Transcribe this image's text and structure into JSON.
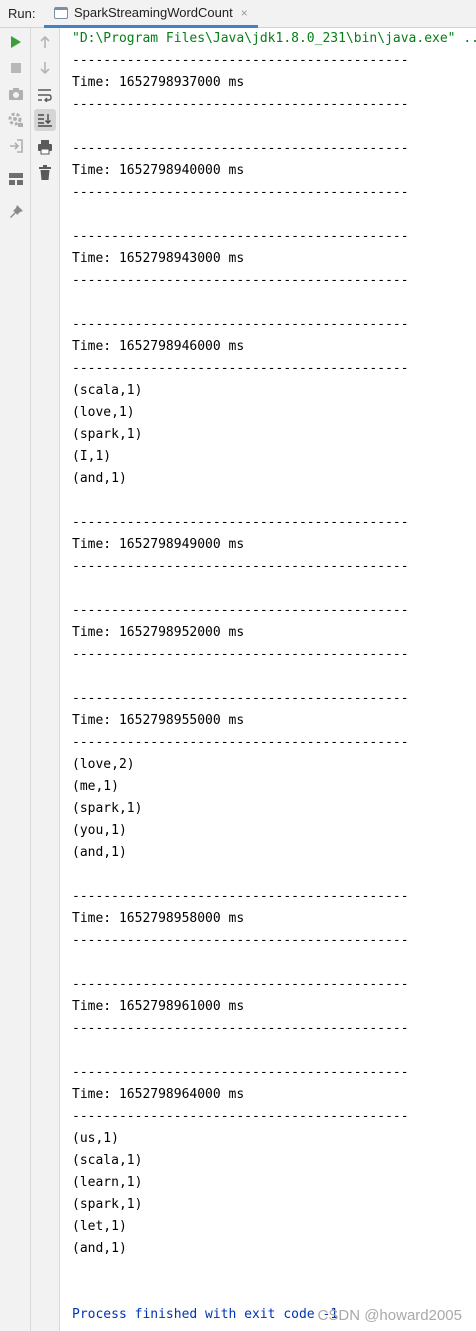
{
  "header": {
    "run_label": "Run:",
    "tab_title": "SparkStreamingWordCount",
    "tab_close": "×"
  },
  "toolbar_icons": [
    "run-icon",
    "stop-icon",
    "camera-icon",
    "settings-icon",
    "exit-icon",
    "layout-icon",
    "pin-icon",
    "arrow-up-icon",
    "arrow-down-icon",
    "soft-wrap-icon",
    "scroll-to-end-icon",
    "print-icon",
    "trash-icon"
  ],
  "console": {
    "command": "\"D:\\Program Files\\Java\\jdk1.8.0_231\\bin\\java.exe\" ...",
    "separator": "-------------------------------------------",
    "blocks": [
      {
        "time": "Time: 1652798937000 ms",
        "records": []
      },
      {
        "time": "Time: 1652798940000 ms",
        "records": []
      },
      {
        "time": "Time: 1652798943000 ms",
        "records": []
      },
      {
        "time": "Time: 1652798946000 ms",
        "records": [
          "(scala,1)",
          "(love,1)",
          "(spark,1)",
          "(I,1)",
          "(and,1)"
        ]
      },
      {
        "time": "Time: 1652798949000 ms",
        "records": []
      },
      {
        "time": "Time: 1652798952000 ms",
        "records": []
      },
      {
        "time": "Time: 1652798955000 ms",
        "records": [
          "(love,2)",
          "(me,1)",
          "(spark,1)",
          "(you,1)",
          "(and,1)"
        ]
      },
      {
        "time": "Time: 1652798958000 ms",
        "records": []
      },
      {
        "time": "Time: 1652798961000 ms",
        "records": []
      },
      {
        "time": "Time: 1652798964000 ms",
        "records": [
          "(us,1)",
          "(scala,1)",
          "(learn,1)",
          "(spark,1)",
          "(let,1)",
          "(and,1)"
        ]
      }
    ],
    "process_finished": "Process finished with exit code -1"
  },
  "watermark": "CSDN @howard2005",
  "colors": {
    "command_text": "#067d17",
    "process_text": "#0033b3",
    "run_icon": "#3a9f3a",
    "tab_underline": "#4083c9"
  }
}
